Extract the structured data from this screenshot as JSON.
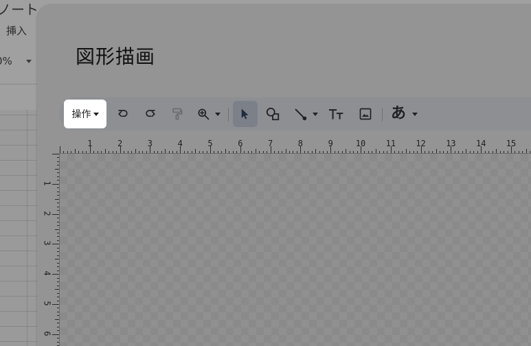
{
  "background_app": {
    "title_fragment": "ノート",
    "menu_item": "挿入",
    "zoom_fragment": "0%"
  },
  "dialog": {
    "title": "図形描画"
  },
  "toolbar": {
    "actions_label": "操作",
    "text_style_label": "あ",
    "icons": [
      "undo-icon",
      "redo-icon",
      "paint-format-icon",
      "zoom-icon",
      "select-cursor-icon",
      "shape-icon",
      "line-icon",
      "text-box-icon",
      "image-icon"
    ]
  },
  "ruler": {
    "horizontal": [
      "1",
      "2",
      "3",
      "4",
      "5",
      "6",
      "7",
      "8",
      "9",
      "10",
      "11",
      "12",
      "13",
      "14",
      "15"
    ],
    "vertical": [
      "1",
      "2",
      "3",
      "4",
      "5",
      "6"
    ]
  },
  "colors": {
    "overlay": "#8a8a8a",
    "dialog": "#949494",
    "toolbar": "#8d8f93",
    "highlight": "#ffffff",
    "selected_tool": "#7b8089"
  }
}
